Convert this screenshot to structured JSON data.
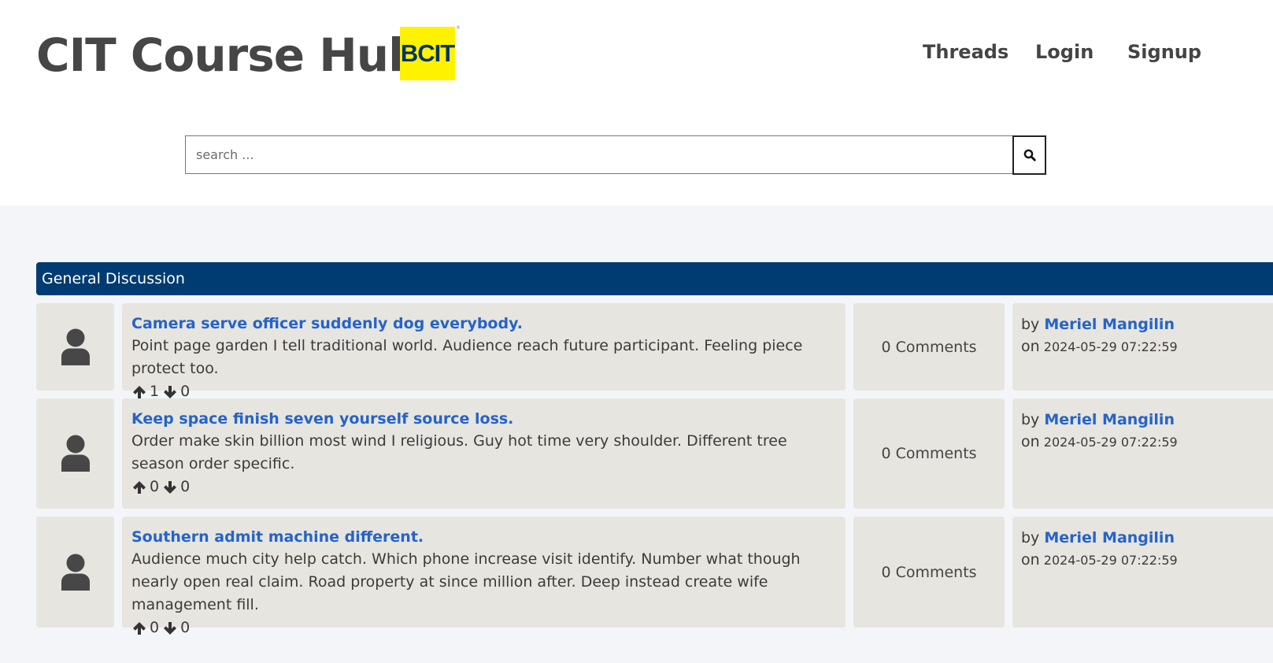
{
  "header": {
    "site_title": "CIT Course Hub",
    "logo_text": "BCIT",
    "logo_color": "#fff200",
    "nav": {
      "threads": "Threads",
      "login": "Login",
      "signup": "Signup"
    }
  },
  "search": {
    "placeholder": "search ...",
    "value": "",
    "button_icon": "search-icon"
  },
  "section": {
    "title": "General Discussion",
    "color": "#003b71"
  },
  "threads": [
    {
      "title": "Camera serve officer suddenly dog everybody.",
      "body": "Point page garden I tell traditional world. Audience reach future participant. Feeling piece protect too.",
      "upvotes": "1",
      "downvotes": "0",
      "comments": "0 Comments",
      "by_prefix": "by",
      "author": "Meriel Mangilin",
      "on_prefix": "on",
      "date": "2024-05-29 07:22:59"
    },
    {
      "title": "Keep space finish seven yourself source loss.",
      "body": "Order make skin billion most wind I religious. Guy hot time very shoulder. Different tree season order specific.",
      "upvotes": "0",
      "downvotes": "0",
      "comments": "0 Comments",
      "by_prefix": "by",
      "author": "Meriel Mangilin",
      "on_prefix": "on",
      "date": "2024-05-29 07:22:59"
    },
    {
      "title": "Southern admit machine different.",
      "body": "Audience much city help catch. Which phone increase visit identify. Number what though nearly open real claim. Road property at since million after. Deep instead create wife management fill.",
      "upvotes": "0",
      "downvotes": "0",
      "comments": "0 Comments",
      "by_prefix": "by",
      "author": "Meriel Mangilin",
      "on_prefix": "on",
      "date": "2024-05-29 07:22:59"
    }
  ],
  "colors": {
    "link": "#2563c9",
    "card_bg": "#e6e5df",
    "page_bg": "#f4f5f8"
  }
}
